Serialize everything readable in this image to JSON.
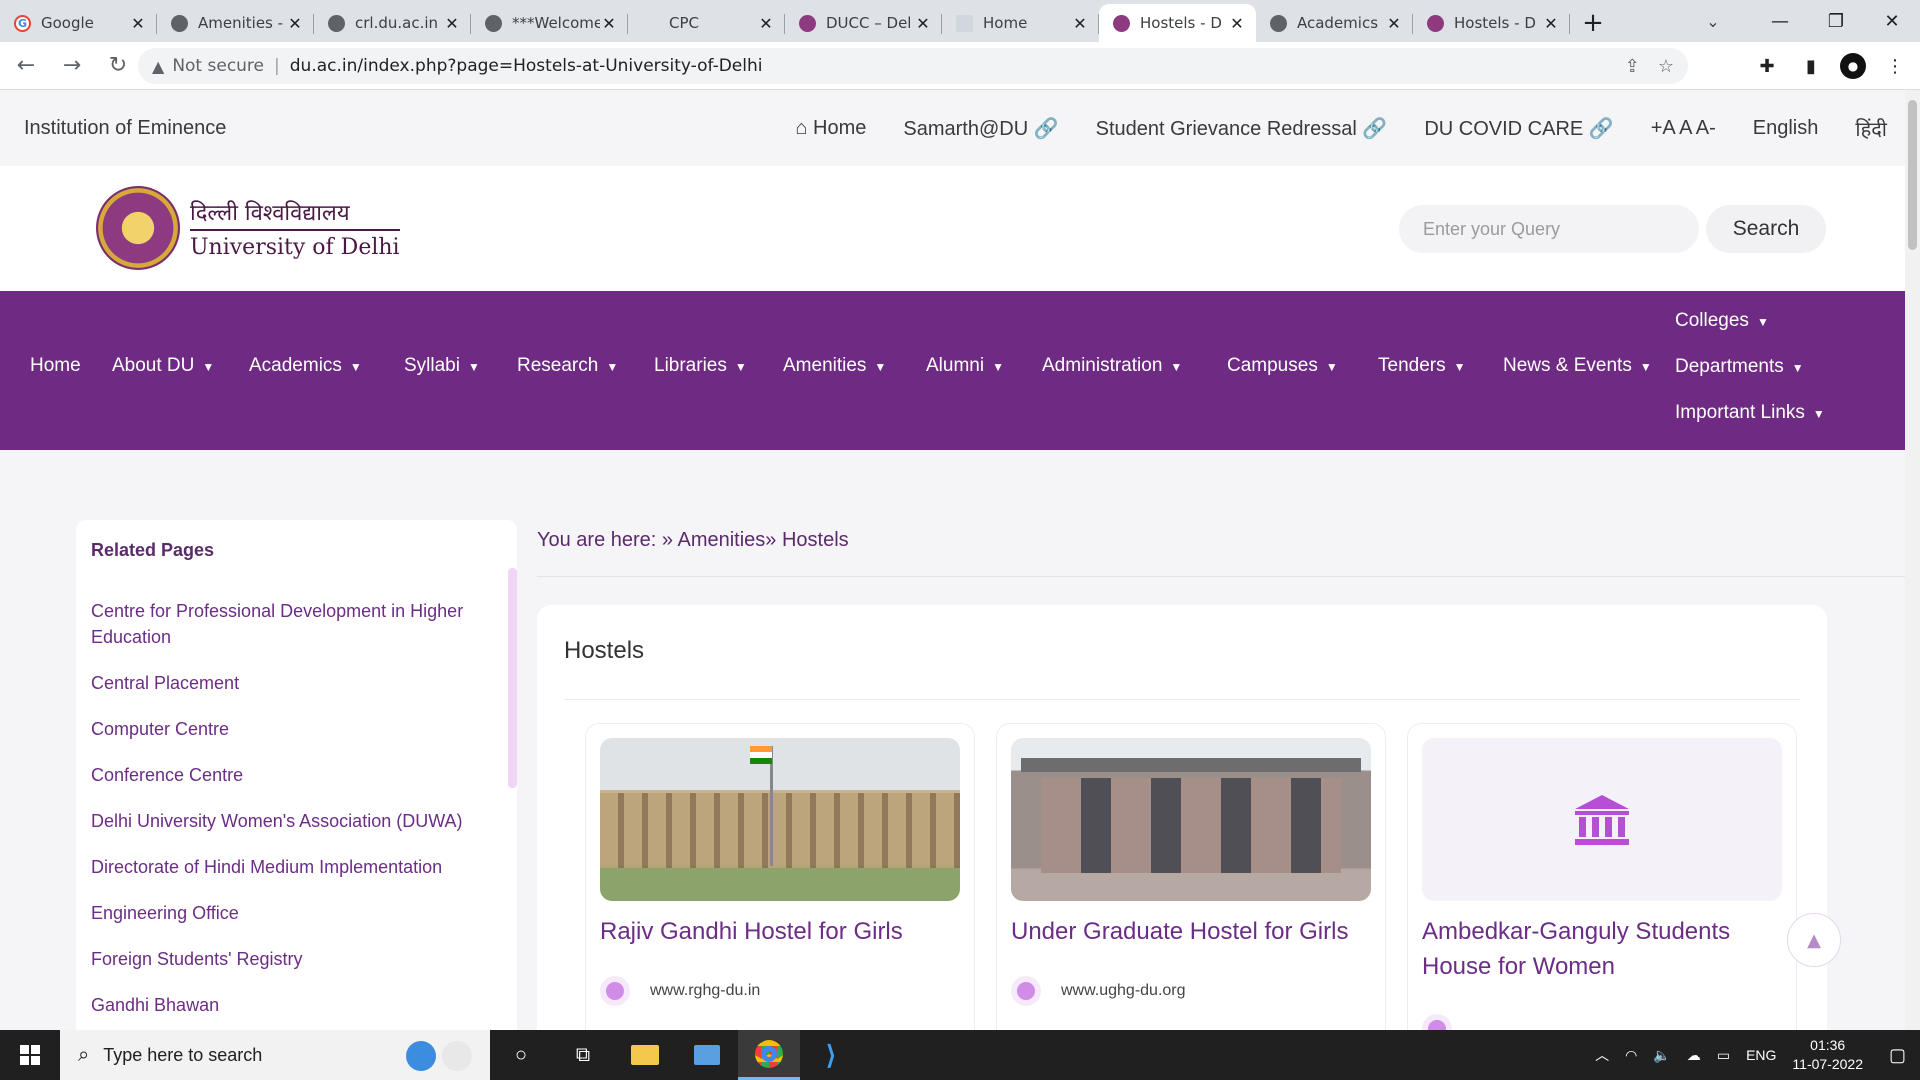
{
  "browser": {
    "tabs": [
      {
        "title": "Google",
        "favicon": "google-icon",
        "active": false
      },
      {
        "title": "Amenities -",
        "favicon": "globe-icon",
        "active": false
      },
      {
        "title": "crl.du.ac.in",
        "favicon": "globe-icon",
        "active": false
      },
      {
        "title": "***Welcome",
        "favicon": "globe-icon",
        "active": false
      },
      {
        "title": "CPC",
        "favicon": "none",
        "active": false
      },
      {
        "title": "DUCC – Del",
        "favicon": "du-seal-icon",
        "active": false
      },
      {
        "title": "Home",
        "favicon": "page-icon",
        "active": false
      },
      {
        "title": "Hostels - D",
        "favicon": "du-seal-icon",
        "active": true
      },
      {
        "title": "Academics",
        "favicon": "globe-icon",
        "active": false
      },
      {
        "title": "Hostels - D",
        "favicon": "du-seal-icon",
        "active": false
      }
    ],
    "close_glyph": "✕",
    "new_tab_glyph": "+",
    "omnibox": {
      "security_label": "Not secure",
      "url": "du.ac.in/index.php?page=Hostels-at-University-of-Delhi"
    }
  },
  "site": {
    "topbar": {
      "left_label": "Institution of Eminence",
      "links": [
        "⌂ Home",
        "Samarth@DU 🔗",
        "Student Grievance Redressal 🔗",
        "DU COVID CARE 🔗",
        "+A A A-",
        "English",
        "हिंदी"
      ]
    },
    "logo": {
      "hindi": "दिल्ली विश्वविद्यालय",
      "english": "University of Delhi"
    },
    "search": {
      "placeholder": "Enter your Query",
      "button_label": "Search"
    },
    "nav": {
      "items": [
        "Home",
        "About DU",
        "Academics",
        "Syllabi",
        "Research",
        "Libraries",
        "Amenities",
        "Alumni",
        "Administration",
        "Campuses",
        "Tenders",
        "News & Events"
      ],
      "right_column": [
        "Colleges",
        "Departments",
        "Important Links"
      ]
    },
    "sidebar": {
      "title": "Related Pages",
      "items": [
        "Centre for Professional Development in Higher Education",
        "Central Placement",
        "Computer Centre",
        "Conference Centre",
        "Delhi University Women's Association (DUWA)",
        "Directorate of Hindi Medium Implementation",
        "Engineering Office",
        "Foreign Students' Registry",
        "Gandhi Bhawan"
      ]
    },
    "breadcrumb": "You are here: » Amenities» Hostels",
    "content": {
      "title": "Hostels",
      "cards": [
        {
          "name": "Rajiv Gandhi Hostel for Girls",
          "website": "www.rghg-du.in"
        },
        {
          "name": "Under Graduate Hostel for Girls",
          "website": "www.ughg-du.org"
        },
        {
          "name": "Ambedkar-Ganguly Students House for Women",
          "website": ""
        }
      ]
    },
    "colors": {
      "nav_bg": "#6f2a83",
      "link": "#6b2d86",
      "accent": "#b44fd6"
    }
  },
  "taskbar": {
    "search_placeholder": "Type here to search",
    "tray": {
      "language": "ENG",
      "time": "01:36",
      "date": "11-07-2022"
    }
  }
}
